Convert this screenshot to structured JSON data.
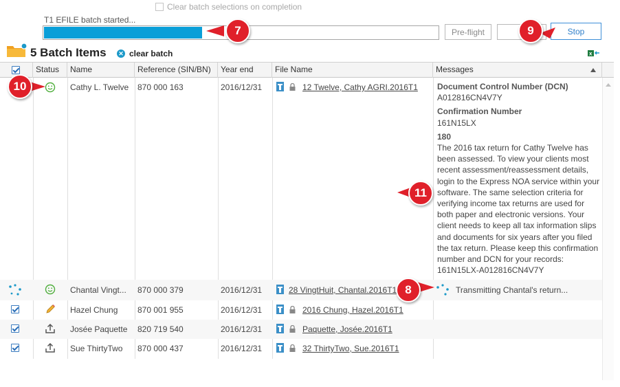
{
  "top": {
    "clear_selections_label": "Clear batch selections on completion",
    "status_text": "T1 EFILE batch started...",
    "progress_fraction": 0.4,
    "preflight_label": "Pre-flight",
    "stop_label": "Stop"
  },
  "batch": {
    "title": "5 Batch Items",
    "clear_batch_label": "clear batch"
  },
  "columns": {
    "status": "Status",
    "name": "Name",
    "reference": "Reference (SIN/BN)",
    "year_end": "Year end",
    "file_name": "File Name",
    "messages": "Messages"
  },
  "rows": [
    {
      "name": "Cathy L. Twelve",
      "reference": "870 000 163",
      "year_end": "2016/12/31",
      "file_name": "12 Twelve, Cathy AGRI.2016T1",
      "status_icon": "smiley-icon",
      "messages": {
        "dcn_label": "Document Control Number (DCN)",
        "dcn_value": "A012816CN4V7Y",
        "confirmation_label": "Confirmation Number",
        "confirmation_value": "161N15LX",
        "code_label": "180",
        "body": "The 2016 tax return for Cathy Twelve has been assessed. To view your clients most recent assessment/reassessment details, login to the Express NOA service within your software. The same selection criteria for verifying income tax returns are used for both paper and electronic versions. Your client needs to keep all tax information slips and documents for six years after you filed the tax return. Please keep this confirmation number and DCN for your records: 161N15LX-A012816CN4V7Y"
      }
    },
    {
      "name": "Chantal Vingt...",
      "reference": "870 000 379",
      "year_end": "2016/12/31",
      "file_name": "28 VingtHuit, Chantal.2016T1",
      "status_icon": "smiley-icon",
      "message": "Transmitting Chantal's return..."
    },
    {
      "name": "Hazel Chung",
      "reference": "870 001 955",
      "year_end": "2016/12/31",
      "file_name": "2016 Chung, Hazel.2016T1",
      "status_icon": "pencil-icon"
    },
    {
      "name": "Josée Paquette",
      "reference": "820 719 540",
      "year_end": "2016/12/31",
      "file_name": "Paquette, Josée.2016T1",
      "status_icon": "upload-icon"
    },
    {
      "name": "Sue ThirtyTwo",
      "reference": "870 000 437",
      "year_end": "2016/12/31",
      "file_name": "32 ThirtyTwo, Sue.2016T1",
      "status_icon": "upload-icon"
    }
  ],
  "callouts": [
    "7",
    "9",
    "10",
    "11",
    "8"
  ],
  "colors": {
    "progress": "#0a9fd8",
    "callout": "#e0202a",
    "smiley": "#4fae3c",
    "spinner": "#1c99c9"
  }
}
